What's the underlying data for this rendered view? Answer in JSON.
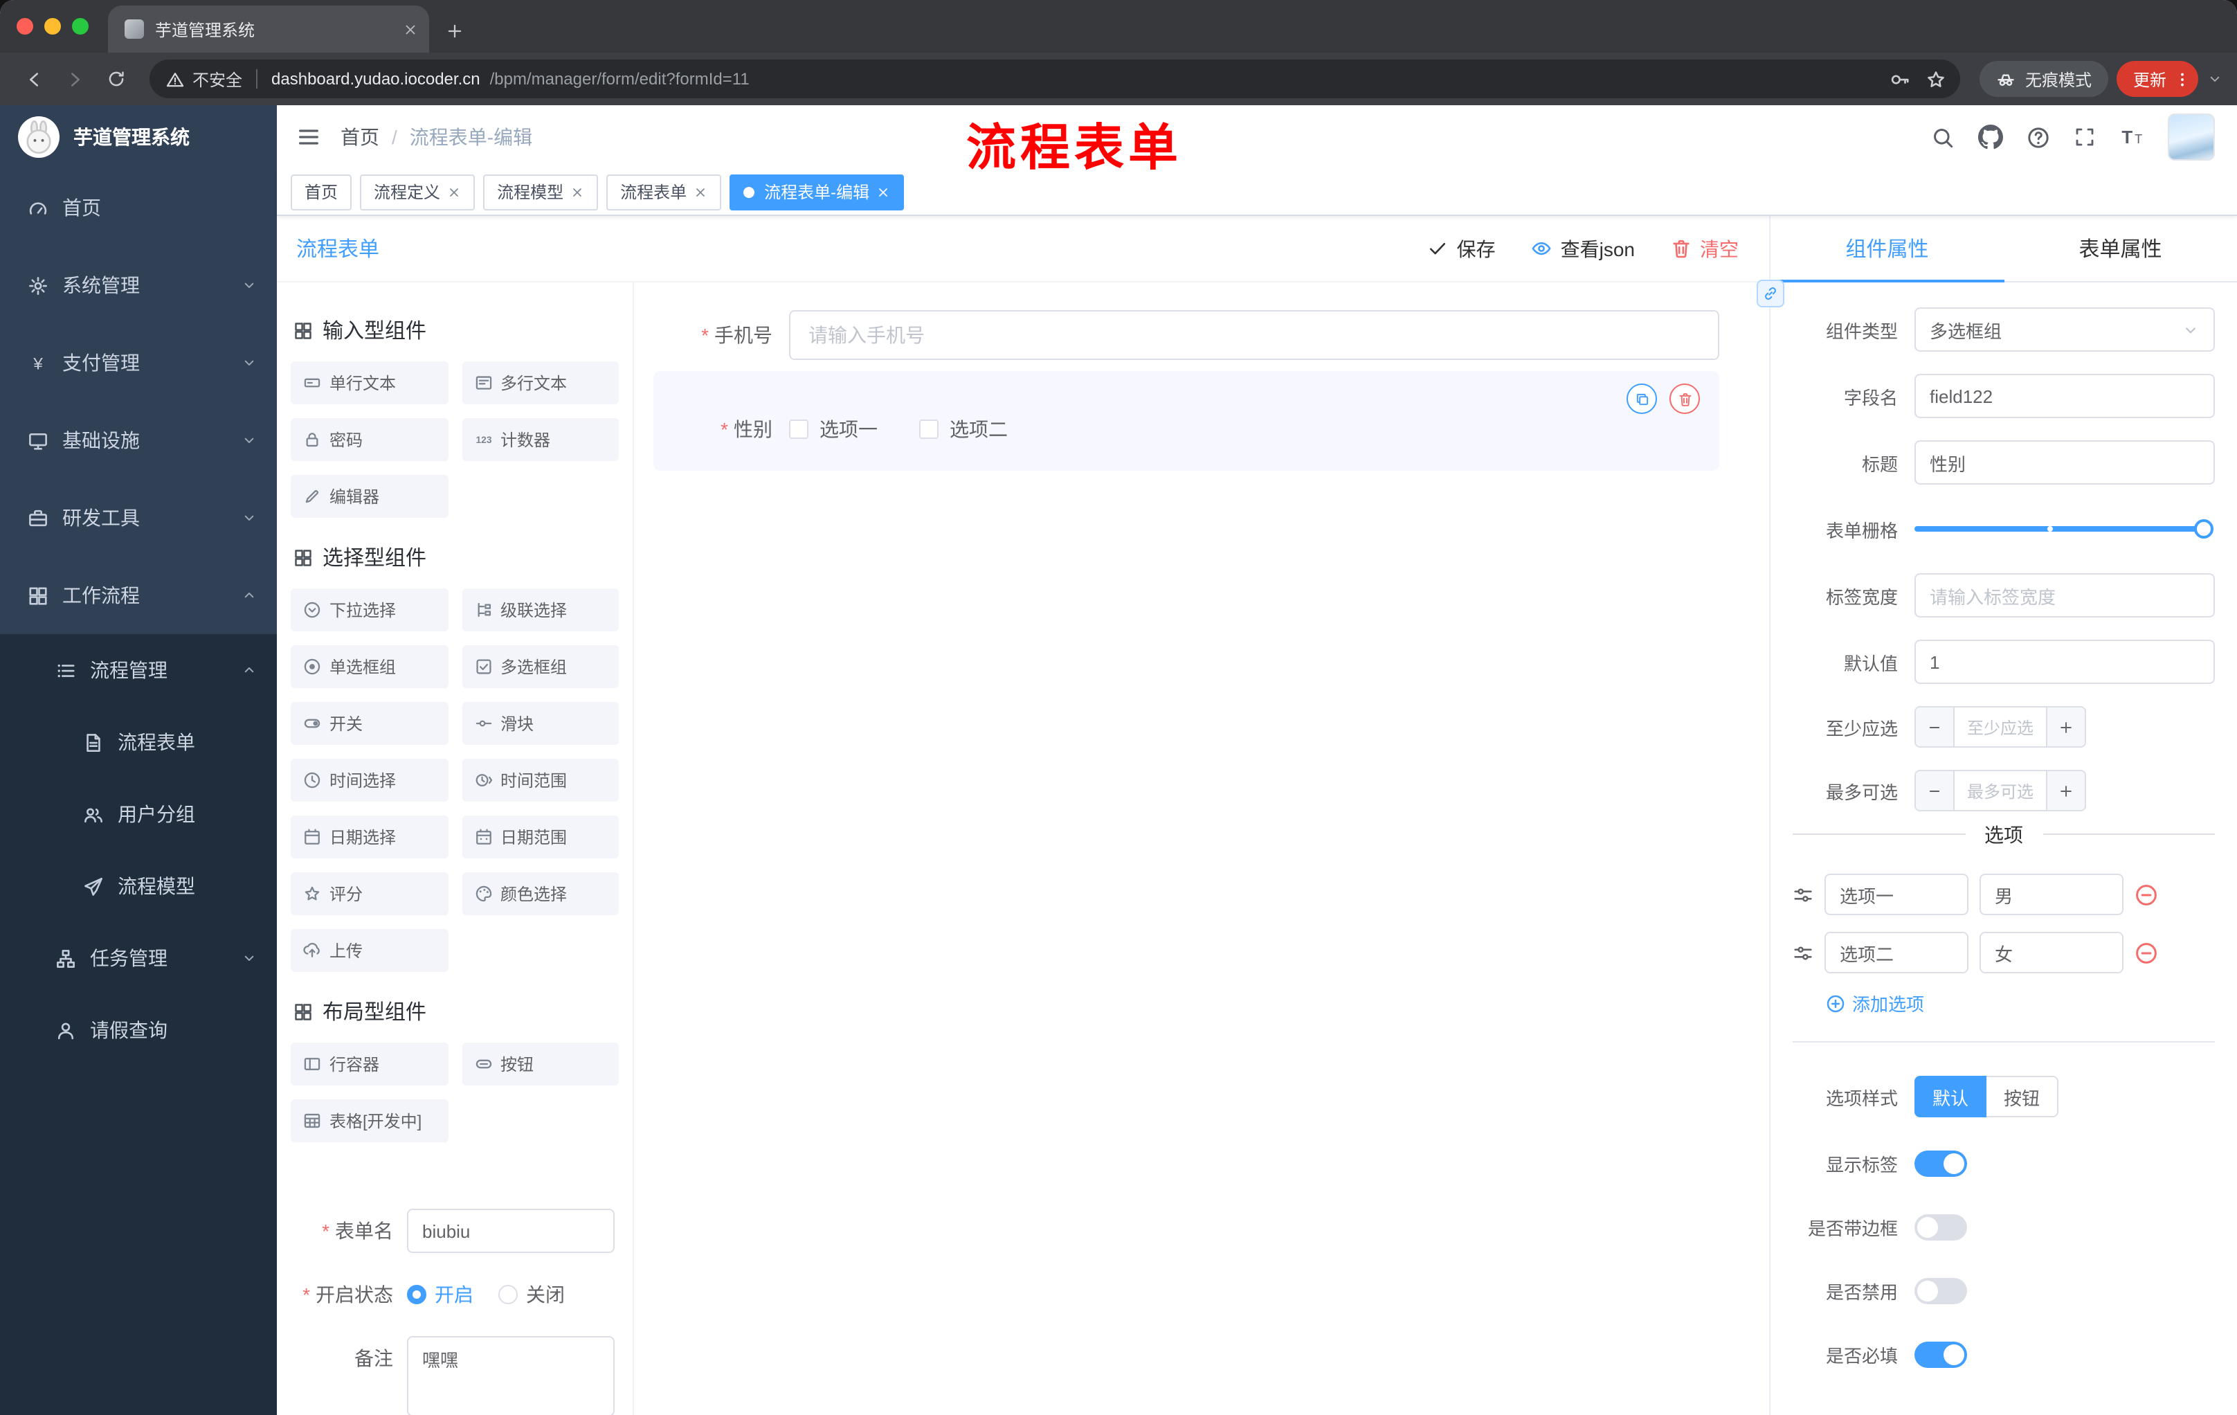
{
  "browser": {
    "tab": {
      "title": "芋道管理系统"
    },
    "toolbar": {
      "security_label": "不安全",
      "url_host": "dashboard.yudao.iocoder.cn",
      "url_path": "/bpm/manager/form/edit?formId=11",
      "incognito_label": "无痕模式",
      "update_label": "更新"
    }
  },
  "annotation": {
    "text": "流程表单",
    "color": "#ff0000"
  },
  "sidebar": {
    "logo_title": "芋道管理系统",
    "items": [
      {
        "name": "home",
        "label": "首页",
        "icon": "gauge",
        "level": 0,
        "expandable": false,
        "expanded": false
      },
      {
        "name": "system",
        "label": "系统管理",
        "icon": "gear",
        "level": 0,
        "expandable": true,
        "expanded": false
      },
      {
        "name": "payment",
        "label": "支付管理",
        "icon": "yen",
        "level": 0,
        "expandable": true,
        "expanded": false
      },
      {
        "name": "infrastructure",
        "label": "基础设施",
        "icon": "monitor",
        "level": 0,
        "expandable": true,
        "expanded": false
      },
      {
        "name": "dev-tools",
        "label": "研发工具",
        "icon": "toolbox",
        "level": 0,
        "expandable": true,
        "expanded": false
      },
      {
        "name": "workflow",
        "label": "工作流程",
        "icon": "grid4",
        "level": 0,
        "expandable": true,
        "expanded": true
      },
      {
        "name": "process-management",
        "label": "流程管理",
        "icon": "list",
        "level": 1,
        "expandable": true,
        "expanded": true
      },
      {
        "name": "process-form",
        "label": "流程表单",
        "icon": "doc",
        "level": 2,
        "expandable": false,
        "expanded": false
      },
      {
        "name": "user-group",
        "label": "用户分组",
        "icon": "users",
        "level": 2,
        "expandable": false,
        "expanded": false
      },
      {
        "name": "process-model",
        "label": "流程模型",
        "icon": "send",
        "level": 2,
        "expandable": false,
        "expanded": false
      },
      {
        "name": "task-management",
        "label": "任务管理",
        "icon": "sitemap",
        "level": 1,
        "expandable": true,
        "expanded": false
      },
      {
        "name": "leave-query",
        "label": "请假查询",
        "icon": "person",
        "level": 1,
        "expandable": false,
        "expanded": false
      }
    ]
  },
  "header": {
    "breadcrumb": {
      "items": [
        "首页",
        "流程表单-编辑"
      ],
      "separator": "/"
    }
  },
  "tags_view": {
    "tags": [
      {
        "name": "home",
        "label": "首页",
        "closable": false,
        "active": false
      },
      {
        "name": "process-definition",
        "label": "流程定义",
        "closable": true,
        "active": false
      },
      {
        "name": "process-model",
        "label": "流程模型",
        "closable": true,
        "active": false
      },
      {
        "name": "process-form",
        "label": "流程表单",
        "closable": true,
        "active": false
      },
      {
        "name": "process-form-edit",
        "label": "流程表单-编辑",
        "closable": true,
        "active": true
      }
    ]
  },
  "designer": {
    "title": "流程表单",
    "actions": [
      {
        "name": "save",
        "label": "保存",
        "icon": "check",
        "style": "dark"
      },
      {
        "name": "view-json",
        "label": "查看json",
        "icon": "eye",
        "style": "dark"
      },
      {
        "name": "clear",
        "label": "清空",
        "icon": "trash",
        "style": "danger"
      }
    ],
    "palette": {
      "groups": [
        {
          "title": "输入型组件",
          "items": [
            {
              "name": "single-line-text",
              "label": "单行文本",
              "icon": "text-field"
            },
            {
              "name": "multi-line-text",
              "label": "多行文本",
              "icon": "textarea"
            },
            {
              "name": "password",
              "label": "密码",
              "icon": "lock"
            },
            {
              "name": "counter",
              "label": "计数器",
              "icon": "counter"
            },
            {
              "name": "editor",
              "label": "编辑器",
              "icon": "pencil"
            }
          ]
        },
        {
          "title": "选择型组件",
          "items": [
            {
              "name": "select",
              "label": "下拉选择",
              "icon": "selecticon"
            },
            {
              "name": "cascader",
              "label": "级联选择",
              "icon": "cascade"
            },
            {
              "name": "radio-group",
              "label": "单选框组",
              "icon": "radio"
            },
            {
              "name": "checkbox-group",
              "label": "多选框组",
              "icon": "checkboxicon"
            },
            {
              "name": "switch",
              "label": "开关",
              "icon": "switchicon"
            },
            {
              "name": "slider",
              "label": "滑块",
              "icon": "sliderh"
            },
            {
              "name": "time-picker",
              "label": "时间选择",
              "icon": "clock"
            },
            {
              "name": "time-range",
              "label": "时间范围",
              "icon": "clock-range"
            },
            {
              "name": "date-picker",
              "label": "日期选择",
              "icon": "calendar"
            },
            {
              "name": "date-range",
              "label": "日期范围",
              "icon": "calendar-range"
            },
            {
              "name": "rate",
              "label": "评分",
              "icon": "star"
            },
            {
              "name": "color-picker",
              "label": "颜色选择",
              "icon": "palette"
            },
            {
              "name": "upload",
              "label": "上传",
              "icon": "upload"
            }
          ]
        },
        {
          "title": "布局型组件",
          "items": [
            {
              "name": "row-container",
              "label": "行容器",
              "icon": "rowc"
            },
            {
              "name": "button",
              "label": "按钮",
              "icon": "buttonc"
            },
            {
              "name": "table",
              "label": "表格[开发中]",
              "icon": "tablec"
            }
          ]
        }
      ]
    },
    "form_config": {
      "name": {
        "label": "表单名",
        "required": true,
        "value": "biubiu"
      },
      "status": {
        "label": "开启状态",
        "required": true,
        "options": [
          {
            "name": "open",
            "label": "开启",
            "checked": true
          },
          {
            "name": "closed",
            "label": "关闭",
            "checked": false
          }
        ]
      },
      "remark": {
        "label": "备注",
        "value": "嘿嘿"
      }
    },
    "canvas": {
      "fields": [
        {
          "name": "phone",
          "type": "input",
          "label": "手机号",
          "required": true,
          "placeholder": "请输入手机号"
        },
        {
          "name": "gender",
          "type": "checkbox-group",
          "label": "性别",
          "required": true,
          "selected": true,
          "options": [
            "选项一",
            "选项二"
          ]
        }
      ]
    }
  },
  "properties": {
    "tabs": [
      {
        "name": "component",
        "label": "组件属性",
        "active": true
      },
      {
        "name": "form",
        "label": "表单属性",
        "active": false
      }
    ],
    "fields": {
      "component_type": {
        "label": "组件类型",
        "value": "多选框组"
      },
      "field_name": {
        "label": "字段名",
        "value": "field122"
      },
      "title": {
        "label": "标题",
        "value": "性别"
      },
      "grid": {
        "label": "表单栅格"
      },
      "label_width": {
        "label": "标签宽度",
        "placeholder": "请输入标签宽度"
      },
      "default_value": {
        "label": "默认值",
        "value": "1"
      },
      "min_selected": {
        "label": "至少应选",
        "placeholder": "至少应选"
      },
      "max_selected": {
        "label": "最多可选",
        "placeholder": "最多可选"
      }
    },
    "options_section": {
      "divider_label": "选项",
      "options": [
        {
          "label": "选项一",
          "value": "男"
        },
        {
          "label": "选项二",
          "value": "女"
        }
      ],
      "add_label": "添加选项"
    },
    "style_section": {
      "option_style_label": "选项样式",
      "style_options": [
        "默认",
        "按钮"
      ],
      "style_selected": "默认",
      "toggles": [
        {
          "name": "show-label",
          "label": "显示标签",
          "on": true
        },
        {
          "name": "with-border",
          "label": "是否带边框",
          "on": false
        },
        {
          "name": "disabled",
          "label": "是否禁用",
          "on": false
        },
        {
          "name": "required",
          "label": "是否必填",
          "on": true
        }
      ]
    }
  },
  "colors": {
    "primary": "#409eff",
    "danger": "#f56c6c",
    "sidebar_bg": "#304156",
    "sidebar_sub_bg": "#1f2d3d",
    "annotation": "#ff0000",
    "update_pill": "#d83a2e",
    "tag_active": "#409eff"
  }
}
